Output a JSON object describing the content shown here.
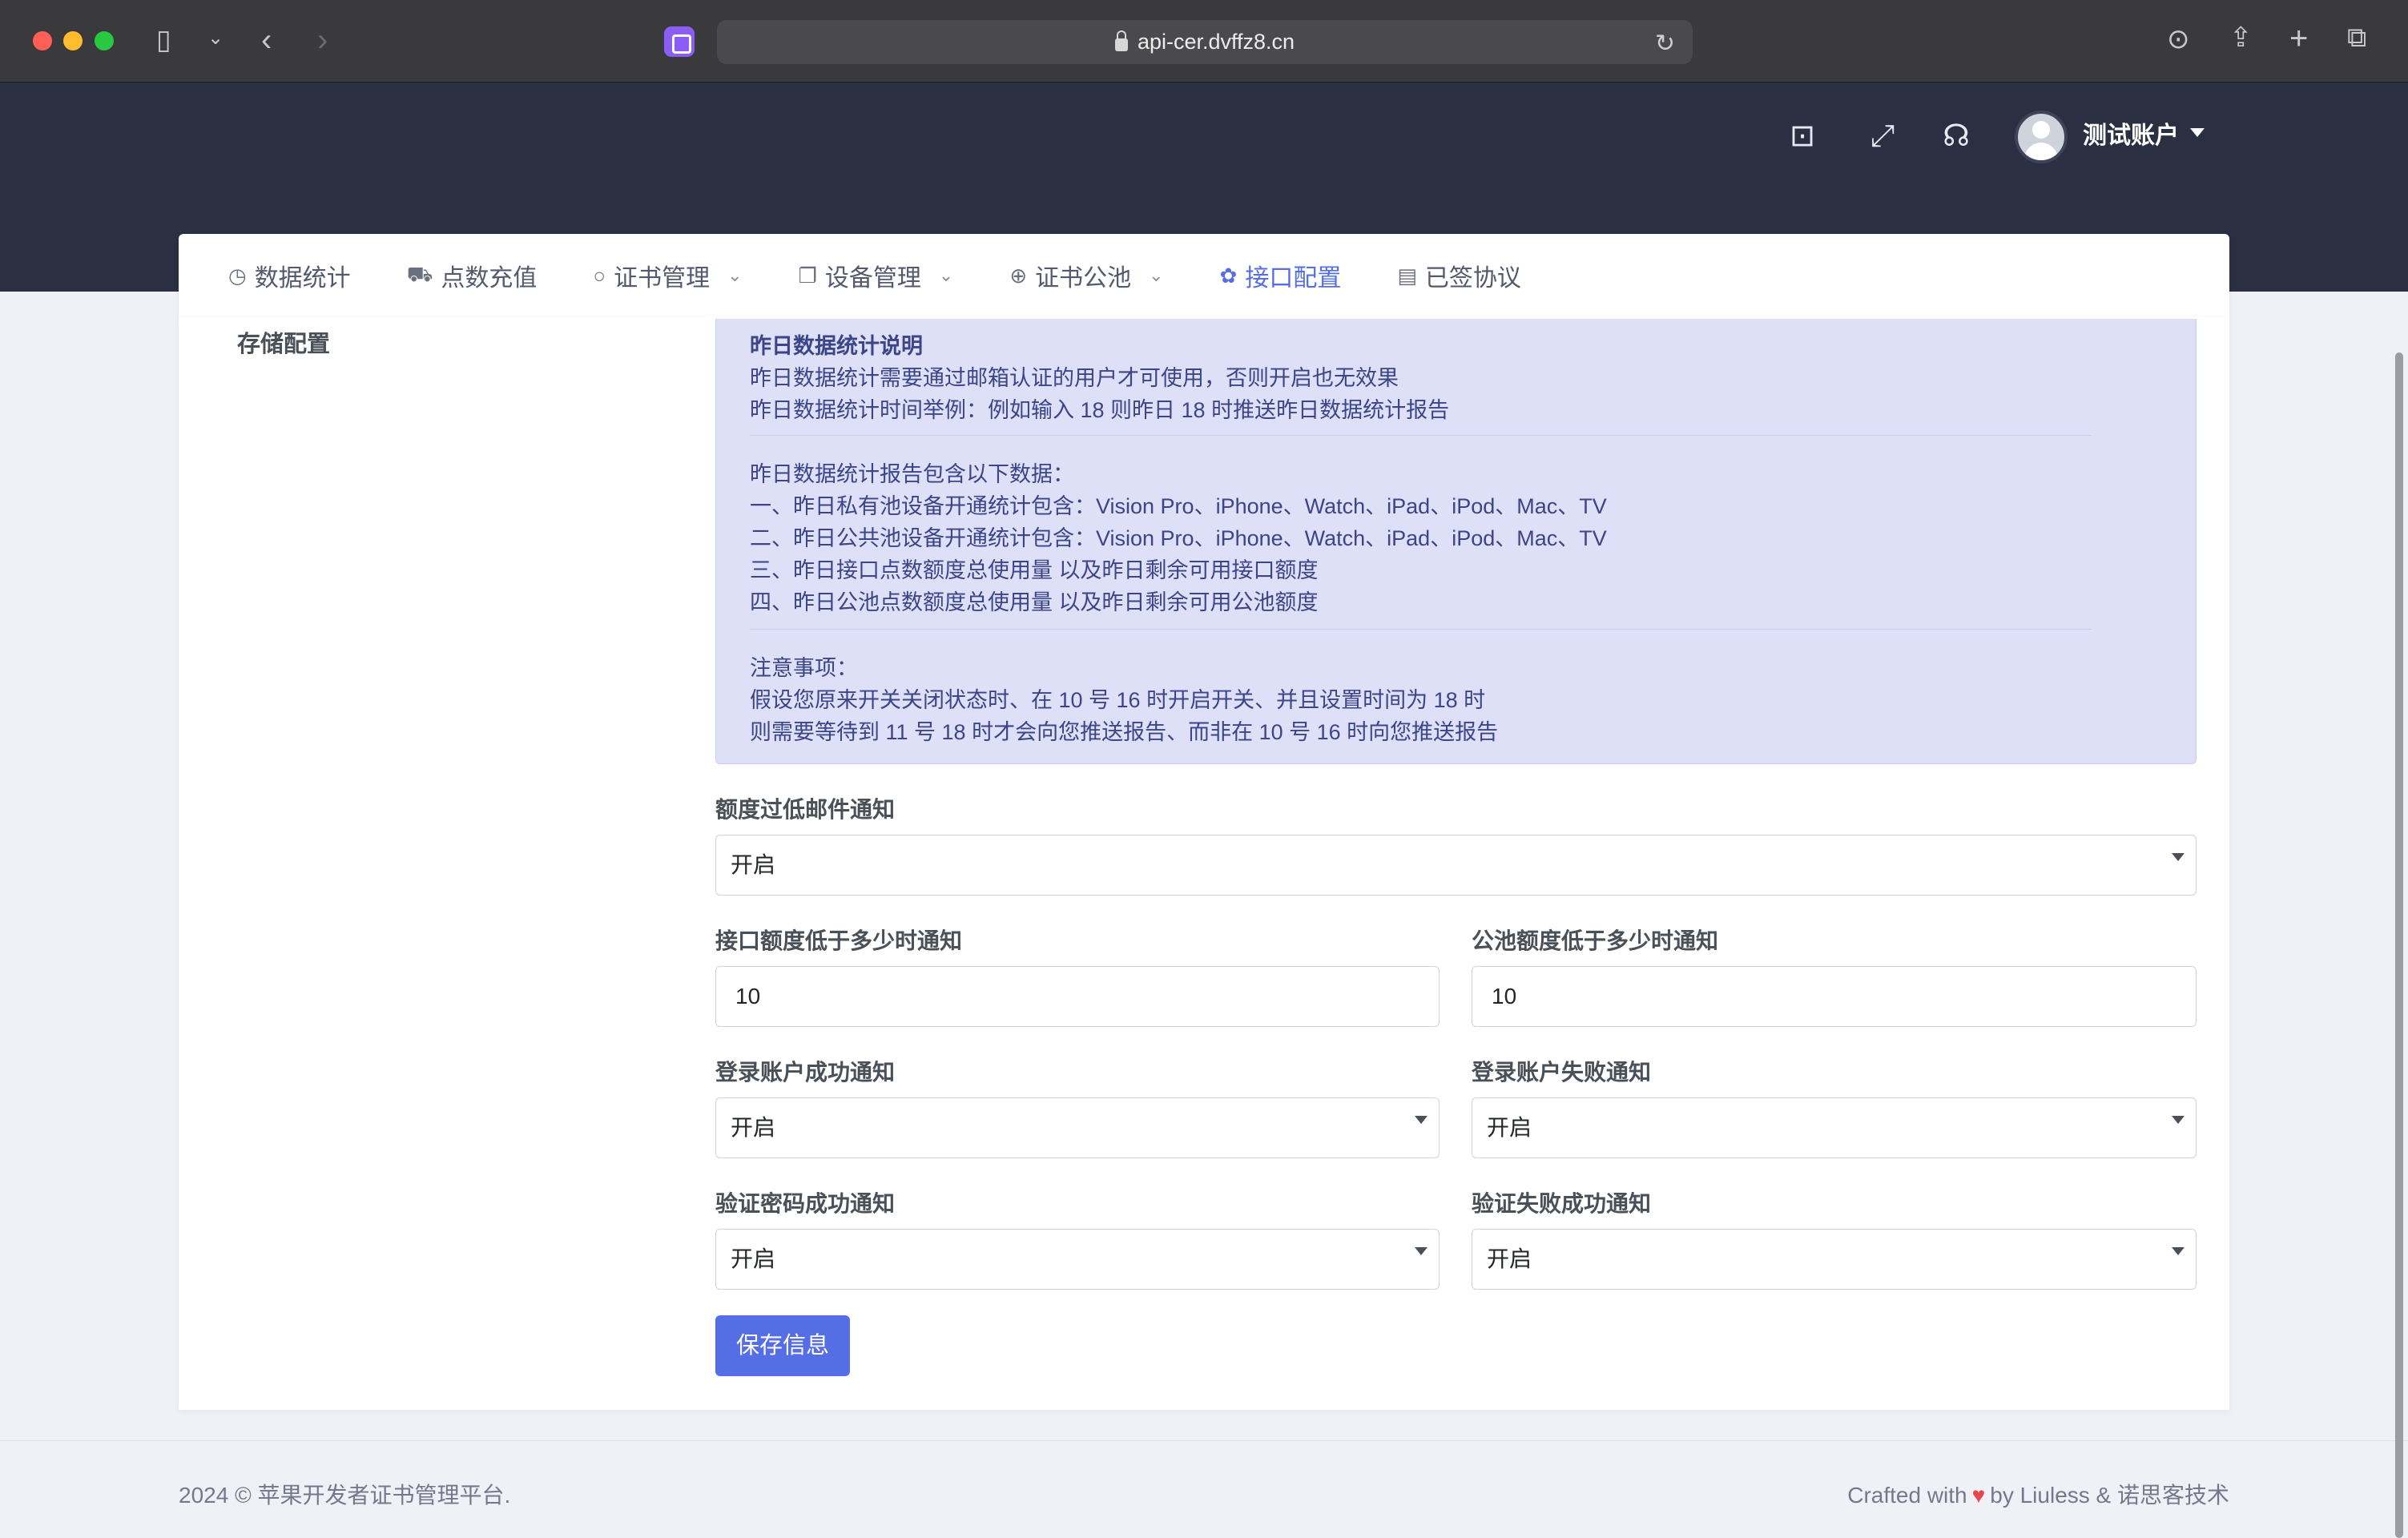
{
  "browser": {
    "url": "api-cer.dvffz8.cn"
  },
  "header": {
    "user_name": "测试账户"
  },
  "nav": {
    "items": [
      {
        "icon": "chart-pie-icon",
        "glyph": "◷",
        "label": "数据统计",
        "dropdown": false,
        "active": false
      },
      {
        "icon": "cart-icon",
        "glyph": "⛟",
        "label": "点数充值",
        "dropdown": false,
        "active": false
      },
      {
        "icon": "circle-icon",
        "glyph": "○",
        "label": "证书管理",
        "dropdown": true,
        "active": false
      },
      {
        "icon": "copy-icon",
        "glyph": "❐",
        "label": "设备管理",
        "dropdown": true,
        "active": false
      },
      {
        "icon": "plus-circle-icon",
        "glyph": "⊕",
        "label": "证书公池",
        "dropdown": true,
        "active": false
      },
      {
        "icon": "puzzle-icon",
        "glyph": "✿",
        "label": "接口配置",
        "dropdown": false,
        "active": true
      },
      {
        "icon": "document-icon",
        "glyph": "▤",
        "label": "已签协议",
        "dropdown": false,
        "active": false
      }
    ]
  },
  "sidebar": {
    "storage_label": "存储配置"
  },
  "notice": {
    "title": "昨日数据统计说明",
    "line1": "昨日数据统计需要通过邮箱认证的用户才可使用，否则开启也无效果",
    "line2": "昨日数据统计时间举例：例如输入 18 则昨日 18 时推送昨日数据统计报告",
    "line3": "昨日数据统计报告包含以下数据：",
    "line4": "一、昨日私有池设备开通统计包含：Vision Pro、iPhone、Watch、iPad、iPod、Mac、TV",
    "line5": "二、昨日公共池设备开通统计包含：Vision Pro、iPhone、Watch、iPad、iPod、Mac、TV",
    "line6": "三、昨日接口点数额度总使用量 以及昨日剩余可用接口额度",
    "line7": "四、昨日公池点数额度总使用量 以及昨日剩余可用公池额度",
    "line8": "注意事项：",
    "line9": "假设您原来开关关闭状态时、在 10 号 16 时开启开关、并且设置时间为 18 时",
    "line10": "则需要等待到 11 号 18 时才会向您推送报告、而非在 10 号 16 时向您推送报告"
  },
  "form": {
    "low_quota_email_label": "额度过低邮件通知",
    "low_quota_email_value": "开启",
    "api_quota_threshold_label": "接口额度低于多少时通知",
    "api_quota_threshold_value": "10",
    "pool_quota_threshold_label": "公池额度低于多少时通知",
    "pool_quota_threshold_value": "10",
    "login_success_label": "登录账户成功通知",
    "login_success_value": "开启",
    "login_fail_label": "登录账户失败通知",
    "login_fail_value": "开启",
    "verify_pwd_success_label": "验证密码成功通知",
    "verify_pwd_success_value": "开启",
    "verify_fail_label": "验证失败成功通知",
    "verify_fail_value": "开启",
    "save_label": "保存信息"
  },
  "footer": {
    "left": "2024 © 苹果开发者证书管理平台.",
    "right_prefix": "Crafted with",
    "right_suffix": "by Liuless & 诺思客技术"
  },
  "colors": {
    "header_bg": "#2a3042",
    "accent": "#556ee6",
    "notice_bg": "#dde0f6",
    "heart": "#e5484d"
  }
}
